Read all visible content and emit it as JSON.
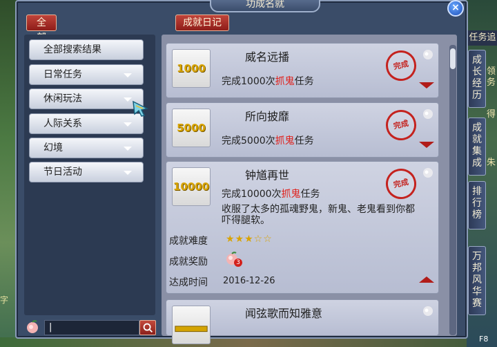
{
  "window": {
    "title": "功成名就",
    "close_label": "×"
  },
  "buttons": {
    "all": "全部",
    "diary": "成就日记"
  },
  "categories": [
    {
      "label": "全部搜索结果",
      "has_arrow": false
    },
    {
      "label": "日常任务",
      "has_arrow": true
    },
    {
      "label": "休闲玩法",
      "has_arrow": true
    },
    {
      "label": "人际关系",
      "has_arrow": true
    },
    {
      "label": "幻境",
      "has_arrow": true
    },
    {
      "label": "节日活动",
      "has_arrow": true
    }
  ],
  "search": {
    "value": "|"
  },
  "achievements": [
    {
      "icon_text": "1000",
      "title": "威名远播",
      "desc_prefix": "完成1000次",
      "desc_highlight": "抓鬼",
      "desc_suffix": "任务",
      "stamp": "完成",
      "expanded": false
    },
    {
      "icon_text": "5000",
      "title": "所向披靡",
      "desc_prefix": "完成5000次",
      "desc_highlight": "抓鬼",
      "desc_suffix": "任务",
      "stamp": "完成",
      "expanded": false
    },
    {
      "icon_text": "10000",
      "title": "钟馗再世",
      "desc_prefix": "完成10000次",
      "desc_highlight": "抓鬼",
      "desc_suffix": "任务",
      "stamp": "完成",
      "expanded": true,
      "flavor_text_1": "收服了太多的孤魂野鬼，新鬼、老鬼看到你都",
      "flavor_text_2": "吓得腿软。",
      "difficulty_label": "成就难度",
      "difficulty_stars": "★★★☆☆",
      "difficulty_value": 3,
      "reward_label": "成就奖励",
      "reward_count": "3",
      "date_label": "达成时间",
      "date": "2016-12-26"
    },
    {
      "title": "闻弦歌而知雅意",
      "expanded": false
    }
  ],
  "side_tabs": [
    {
      "label": "成长经历"
    },
    {
      "label": "成就集成"
    },
    {
      "label": "排行榜"
    },
    {
      "label": "万邦风华赛"
    }
  ],
  "side_top_label": "任务追",
  "side_right_texts": [
    "领",
    "务",
    "得",
    "朱"
  ],
  "left_bg_text": "字",
  "hotkey_label": "F8",
  "colors": {
    "accent_red": "#c4221e",
    "highlight_text": "#e0201b",
    "star": "#d9a300"
  }
}
